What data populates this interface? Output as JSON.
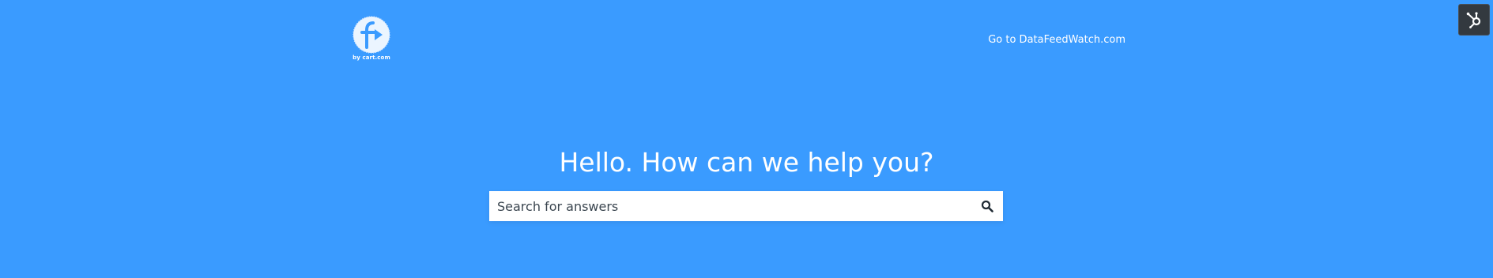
{
  "brand": {
    "tagline": "by cart.com",
    "logo_letter": "f"
  },
  "header": {
    "link_label": "Go to DataFeedWatch.com"
  },
  "hero": {
    "title": "Hello. How can we help you?"
  },
  "search": {
    "placeholder": "Search for answers",
    "icon": "search-icon"
  },
  "widget": {
    "icon": "hubspot-icon"
  },
  "colors": {
    "background": "#3a9bff",
    "text_on_bg": "#ffffff",
    "widget_bg": "#33393f",
    "search_text": "#3b4650"
  }
}
